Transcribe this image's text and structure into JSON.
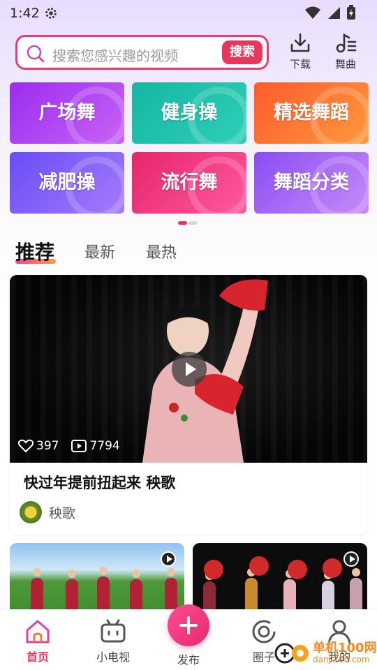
{
  "status_bar": {
    "time": "1:42"
  },
  "search": {
    "placeholder": "搜索您感兴趣的视频",
    "button": "搜索"
  },
  "tools": {
    "download": "下载",
    "music": "舞曲"
  },
  "categories": [
    {
      "label": "广场舞",
      "color1": "#9a2df0",
      "color2": "#c963f5"
    },
    {
      "label": "健身操",
      "color1": "#16b6a4",
      "color2": "#2ecfb7"
    },
    {
      "label": "精选舞蹈",
      "color1": "#ff5a2e",
      "color2": "#ff9a3c"
    },
    {
      "label": "减肥操",
      "color1": "#6a4cf6",
      "color2": "#a57bfb"
    },
    {
      "label": "流行舞",
      "color1": "#e6246b",
      "color2": "#ff5aa0"
    },
    {
      "label": "舞蹈分类",
      "color1": "#8b4df3",
      "color2": "#c78bf9"
    }
  ],
  "tabs": [
    "推荐",
    "最新",
    "最热"
  ],
  "featured": {
    "likes": "397",
    "plays": "7794",
    "title": "快过年提前扭起来  秧歌",
    "author": "秧歌"
  },
  "nav": {
    "home": "首页",
    "tv": "小电视",
    "publish": "发布",
    "circle": "圈子",
    "mine": "我的"
  },
  "watermark": {
    "line1": "单机100网",
    "line2": "danji100.com"
  },
  "colors": {
    "accent": "#e8365c"
  }
}
